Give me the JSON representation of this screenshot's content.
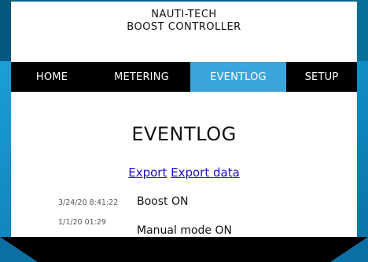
{
  "header": {
    "line1": "NAUTI-TECH",
    "line2": "BOOST CONTROLLER"
  },
  "nav": {
    "items": [
      {
        "label": "HOME"
      },
      {
        "label": "METERING"
      },
      {
        "label": "EVENTLOG",
        "active": true
      },
      {
        "label": "SETUP"
      }
    ]
  },
  "main": {
    "title": "EVENTLOG",
    "links": {
      "export": "Export",
      "export_data": "Export data"
    },
    "events": [
      {
        "timestamp": "3/24/20 8:41:22",
        "message": "Boost ON"
      },
      {
        "timestamp": "1/1/20 01:29",
        "message": "Manual mode ON"
      }
    ]
  },
  "colors": {
    "nav_active": "#3aa5dd",
    "nav_background": "#000000",
    "link": "#1a0dcc",
    "page_background": "#1a9fd6"
  }
}
